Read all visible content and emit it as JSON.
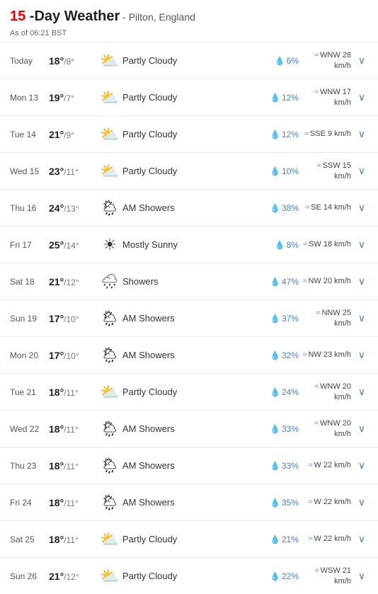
{
  "header": {
    "day_count": "15",
    "title": " -Day Weather",
    "location": " - Pilton, England",
    "as_of": "As of 06:21 BST"
  },
  "rows": [
    {
      "day": "Today",
      "high": "18°",
      "low": "8°",
      "icon": "partly-cloudy",
      "desc": "Partly Cloudy",
      "precip": "6%",
      "wind": "WNW 28 km/h"
    },
    {
      "day": "Mon 13",
      "high": "19°",
      "low": "7°",
      "icon": "partly-cloudy",
      "desc": "Partly Cloudy",
      "precip": "12%",
      "wind": "WNW 17 km/h"
    },
    {
      "day": "Tue 14",
      "high": "21°",
      "low": "9°",
      "icon": "partly-cloudy",
      "desc": "Partly Cloudy",
      "precip": "12%",
      "wind": "SSE 9 km/h"
    },
    {
      "day": "Wed 15",
      "high": "23°",
      "low": "11°",
      "icon": "partly-cloudy",
      "desc": "Partly Cloudy",
      "precip": "10%",
      "wind": "SSW 15 km/h"
    },
    {
      "day": "Thu 16",
      "high": "24°",
      "low": "13°",
      "icon": "am-showers",
      "desc": "AM Showers",
      "precip": "38%",
      "wind": "SE 14 km/h"
    },
    {
      "day": "Fri 17",
      "high": "25°",
      "low": "14°",
      "icon": "mostly-sunny",
      "desc": "Mostly Sunny",
      "precip": "8%",
      "wind": "SW 18 km/h"
    },
    {
      "day": "Sat 18",
      "high": "21°",
      "low": "12°",
      "icon": "showers",
      "desc": "Showers",
      "precip": "47%",
      "wind": "NW 20 km/h"
    },
    {
      "day": "Sun 19",
      "high": "17°",
      "low": "10°",
      "icon": "am-showers",
      "desc": "AM Showers",
      "precip": "37%",
      "wind": "NNW 25 km/h"
    },
    {
      "day": "Mon 20",
      "high": "17°",
      "low": "10°",
      "icon": "am-showers",
      "desc": "AM Showers",
      "precip": "32%",
      "wind": "NW 23 km/h"
    },
    {
      "day": "Tue 21",
      "high": "18°",
      "low": "11°",
      "icon": "partly-cloudy",
      "desc": "Partly Cloudy",
      "precip": "24%",
      "wind": "WNW 20 km/h"
    },
    {
      "day": "Wed 22",
      "high": "18°",
      "low": "11°",
      "icon": "am-showers",
      "desc": "AM Showers",
      "precip": "33%",
      "wind": "WNW 20 km/h"
    },
    {
      "day": "Thu 23",
      "high": "18°",
      "low": "11°",
      "icon": "am-showers",
      "desc": "AM Showers",
      "precip": "33%",
      "wind": "W 22 km/h"
    },
    {
      "day": "Fri 24",
      "high": "18°",
      "low": "11°",
      "icon": "am-showers",
      "desc": "AM Showers",
      "precip": "35%",
      "wind": "W 22 km/h"
    },
    {
      "day": "Sat 25",
      "high": "18°",
      "low": "11°",
      "icon": "partly-cloudy",
      "desc": "Partly Cloudy",
      "precip": "21%",
      "wind": "W 22 km/h"
    },
    {
      "day": "Sun 26",
      "high": "21°",
      "low": "12°",
      "icon": "partly-cloudy",
      "desc": "Partly Cloudy",
      "precip": "22%",
      "wind": "WSW 21 km/h"
    }
  ]
}
